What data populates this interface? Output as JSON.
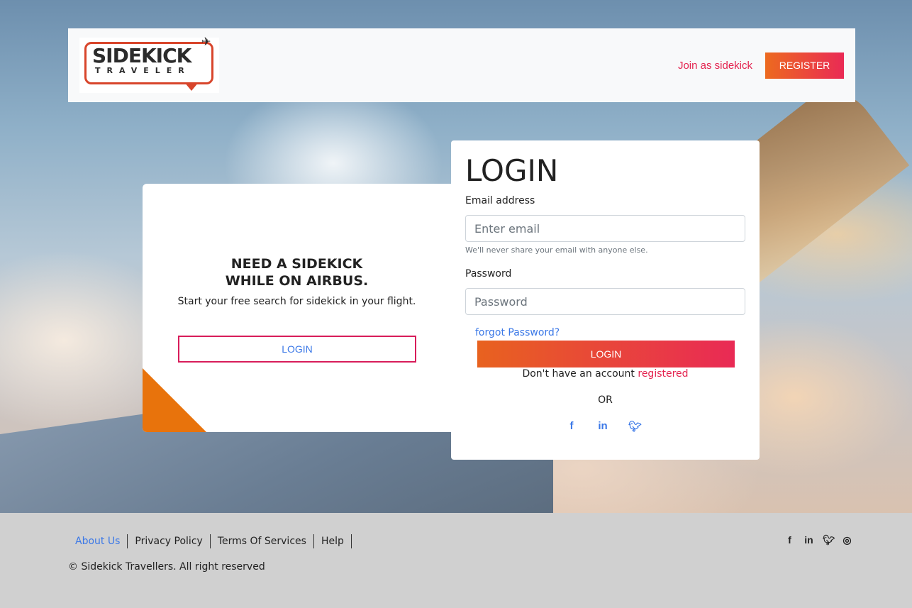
{
  "header": {
    "logo_main": "SIDEKICK",
    "logo_sub": "TRAVELER",
    "join_link": "Join as sidekick",
    "register_label": "REGISTER"
  },
  "promo": {
    "title": "NEED A SIDEKICK\nWHILE ON AIRBUS.",
    "subtitle": "Start your free search for sidekick in your flight.",
    "login_label": "LOGIN"
  },
  "login": {
    "title": "LOGIN",
    "email_label": "Email address",
    "email_placeholder": "Enter email",
    "email_hint": "We'll never share your email with anyone else.",
    "password_label": "Password",
    "password_placeholder": "Password",
    "forgot_label": "forgot Password?",
    "submit_label": "LOGIN",
    "no_account_text": "Don't have an account",
    "registered_link": "registered",
    "or_text": "OR",
    "social_icons": [
      "facebook-icon",
      "linkedin-icon",
      "twitter-icon"
    ]
  },
  "footer": {
    "links": [
      "About Us",
      "Privacy Policy",
      "Terms Of Services",
      "Help"
    ],
    "copyright": "© Sidekick Travellers. All right reserved",
    "social_icons": [
      "facebook-icon",
      "linkedin-icon",
      "twitter-icon",
      "instagram-icon"
    ]
  },
  "colors": {
    "accent_pink": "#e4234f",
    "accent_orange": "#ec6a1f",
    "link_blue": "#3b78e7",
    "corner_orange": "#e8730c"
  }
}
